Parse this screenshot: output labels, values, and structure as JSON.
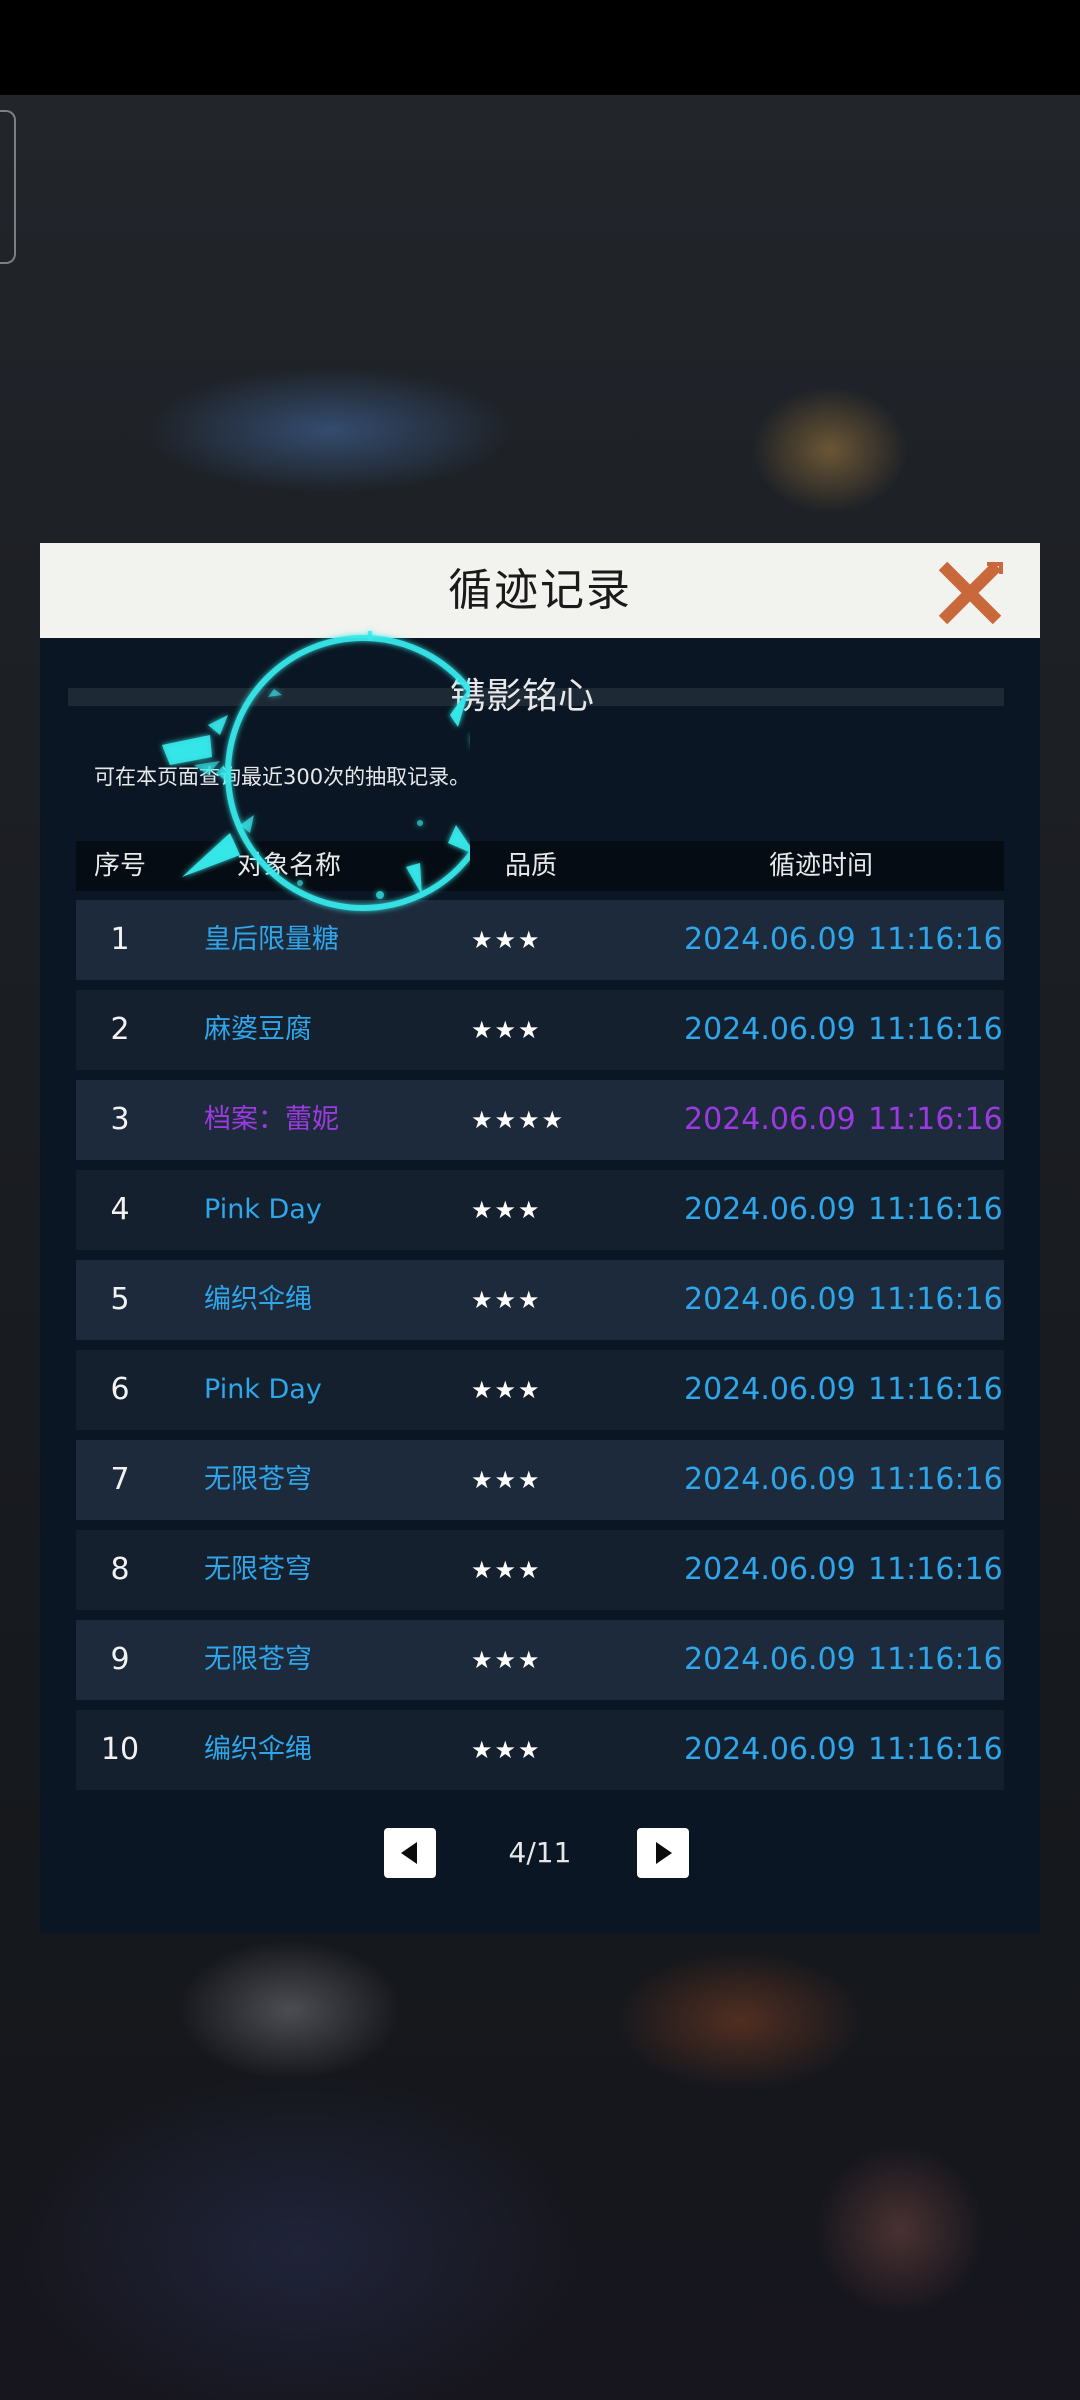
{
  "dialog": {
    "title": "循迹记录",
    "banner_title": "镌影铭心",
    "query_note": "可在本页面查询最近300次的抽取记录。"
  },
  "table": {
    "headers": {
      "index": "序号",
      "name": "对象名称",
      "quality": "品质",
      "time": "循迹时间"
    },
    "rows": [
      {
        "index": "1",
        "name": "皇后限量糖",
        "stars": "★★★",
        "date": "2024.06.09",
        "time": "11:16:16"
      },
      {
        "index": "2",
        "name": "麻婆豆腐",
        "stars": "★★★",
        "date": "2024.06.09",
        "time": "11:16:16"
      },
      {
        "index": "3",
        "name": "档案：蕾妮",
        "stars": "★★★★",
        "date": "2024.06.09",
        "time": "11:16:16"
      },
      {
        "index": "4",
        "name": "Pink Day",
        "stars": "★★★",
        "date": "2024.06.09",
        "time": "11:16:16"
      },
      {
        "index": "5",
        "name": "编织伞绳",
        "stars": "★★★",
        "date": "2024.06.09",
        "time": "11:16:16"
      },
      {
        "index": "6",
        "name": "Pink Day",
        "stars": "★★★",
        "date": "2024.06.09",
        "time": "11:16:16"
      },
      {
        "index": "7",
        "name": "无限苍穹",
        "stars": "★★★",
        "date": "2024.06.09",
        "time": "11:16:16"
      },
      {
        "index": "8",
        "name": "无限苍穹",
        "stars": "★★★",
        "date": "2024.06.09",
        "time": "11:16:16"
      },
      {
        "index": "9",
        "name": "无限苍穹",
        "stars": "★★★",
        "date": "2024.06.09",
        "time": "11:16:16"
      },
      {
        "index": "10",
        "name": "编织伞绳",
        "stars": "★★★",
        "date": "2024.06.09",
        "time": "11:16:16"
      }
    ]
  },
  "pager": {
    "page": "4/11",
    "prev_icon": "triangle-left-icon",
    "next_icon": "triangle-right-icon"
  },
  "colors": {
    "item_blue": "#2fa5ea",
    "item_purple": "#9b3ae0",
    "close_orange": "#c9683a",
    "ring_cyan": "#35e8ea"
  },
  "icons": {
    "close": "close-icon",
    "loading": "loading-ring-icon"
  }
}
